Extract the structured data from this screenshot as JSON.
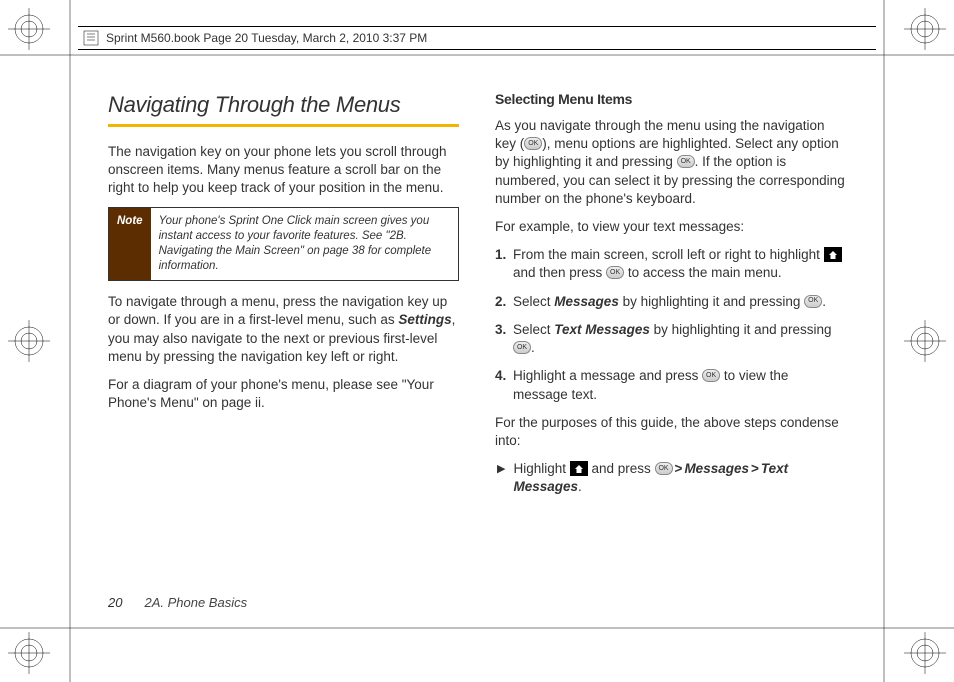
{
  "header": {
    "doc_title": "Sprint M560.book  Page 20  Tuesday, March 2, 2010  3:37 PM"
  },
  "left": {
    "heading": "Navigating Through the Menus",
    "p1": "The navigation key on your phone lets you scroll through onscreen items. Many menus feature a scroll bar on the right to help you keep track of your position in the menu.",
    "note_label": "Note",
    "note_text": "Your phone's Sprint One Click main screen gives you instant access to your favorite features. See \"2B. Navigating the Main Screen\" on page 38 for complete information.",
    "p2a": "To navigate through a menu, press the navigation key up or down. If you are in a first-level menu, such as ",
    "p2_settings": "Settings",
    "p2b": ", you may also navigate to the next or previous first-level menu by pressing the navigation key left or right.",
    "p3": "For a diagram of your phone's menu, please see \"Your Phone's Menu\" on page ii."
  },
  "right": {
    "subheading": "Selecting Menu Items",
    "p1a": "As you navigate through the menu using the navigation key (",
    "p1b": "), menu options are highlighted. Select any option by highlighting it and pressing ",
    "p1c": ". If the option is numbered, you can select it by pressing the corresponding number on the phone's keyboard.",
    "p2": "For example, to view your text messages:",
    "step1a": "From the main screen, scroll left or right to highlight ",
    "step1b": " and then press ",
    "step1c": " to access the main menu.",
    "step2a": "Select ",
    "step2_messages": "Messages",
    "step2b": " by highlighting it and pressing ",
    "step2c": ".",
    "step3a": "Select ",
    "step3_tm": "Text Messages",
    "step3b": " by highlighting it and pressing ",
    "step3c": ".",
    "step4a": "Highlight a message and press ",
    "step4b": " to view the message text.",
    "p3": "For the purposes of this guide, the above steps condense into:",
    "bullet_a": "Highlight ",
    "bullet_b": " and press ",
    "bullet_msgs": "Messages",
    "bullet_gt": ">",
    "bullet_tm": "Text Messages",
    "bullet_end": "."
  },
  "footer": {
    "page_number": "20",
    "section": "2A. Phone Basics"
  },
  "icons": {
    "ok": "OK"
  }
}
